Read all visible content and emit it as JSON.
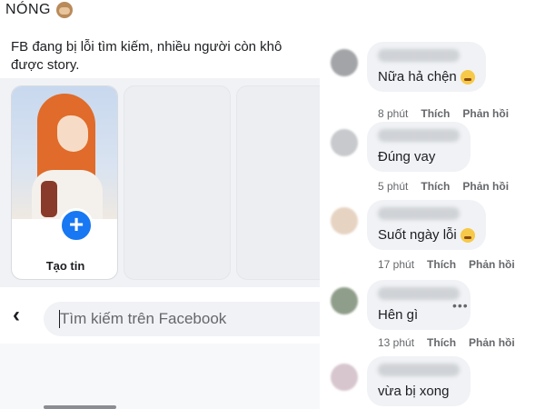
{
  "post": {
    "title": "NÓNG",
    "title_icon": "see-no-evil-monkey-icon",
    "body_line1": "FB đang bị lỗi tìm kiếm, nhiều người còn khô",
    "body_line2": "được story."
  },
  "stories": {
    "create_label": "Tạo tin",
    "create_icon": "plus-icon",
    "accent_color": "#1877f2"
  },
  "search": {
    "back_icon": "chevron-left-icon",
    "placeholder": "Tìm kiếm trên Facebook"
  },
  "comments": [
    {
      "text": "Nữa hả chện",
      "emoji": "smile-sweat-emoji",
      "time": "8 phút",
      "like": "Thích",
      "reply": "Phản hồi"
    },
    {
      "text": "Đúng vay",
      "emoji": "",
      "time": "5 phút",
      "like": "Thích",
      "reply": "Phản hồi"
    },
    {
      "text": "Suốt ngày lỗi",
      "emoji": "smile-sweat-emoji",
      "time": "17 phút",
      "like": "Thích",
      "reply": "Phản hồi"
    },
    {
      "text": "Hên gì",
      "emoji": "",
      "time": "13 phút",
      "like": "Thích",
      "reply": "Phản hồi",
      "more": "•••"
    },
    {
      "text": "vừa bị xong",
      "emoji": ""
    }
  ]
}
